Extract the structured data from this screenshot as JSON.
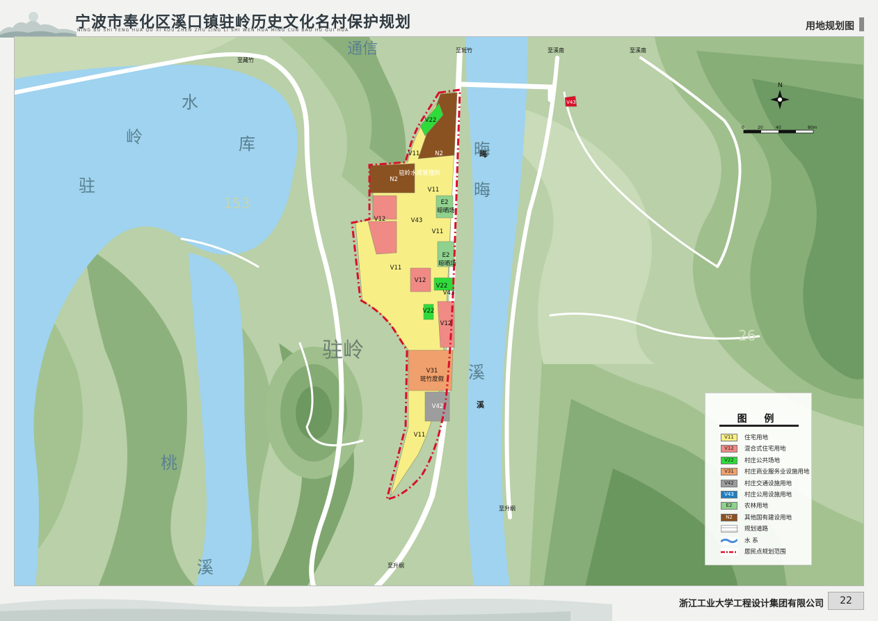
{
  "header": {
    "title": "宁波市奉化区溪口镇驻岭历史文化名村保护规划",
    "pinyin": "NING BO SHI FENG HUA QU XI KOU ZHEN ZHU LING LI SHI WEN HUA MING CUN BAO HU GUI HUA",
    "sheet_title": "用地规划图"
  },
  "footer": {
    "company": "浙江工业大学工程设计集团有限公司",
    "page_number": "22"
  },
  "map": {
    "place_labels": {
      "reservoir_chars": [
        "驻",
        "岭",
        "水",
        "库"
      ],
      "village": "驻岭",
      "stream_big": [
        "晦",
        "晦",
        "溪"
      ],
      "stream_small": [
        "晦",
        "溪"
      ],
      "peach": "桃",
      "xi": "溪",
      "tongxin": "通信"
    },
    "directions": {
      "to_zhuzhu": "至藏竹",
      "to_banzhu": "至斑竹",
      "to_xinan_1": "至溪南",
      "to_xinan_2": "至溪南",
      "to_shenggang_1": "至升纲",
      "to_shenggang_2": "至升纲"
    },
    "parcels": {
      "v22_top": "V22",
      "v11_a": "V11",
      "n2_right": "N2",
      "n2_left": "N2",
      "mgmt_name": "驻岭水库管理所",
      "v11_b": "V11",
      "e2_a": "E2",
      "e2_a_name": "晾晒场",
      "v12_a": "V12",
      "v43_a": "V43",
      "v11_c": "V11",
      "e2_b": "E2",
      "e2_b_name": "晾晒场",
      "v11_d": "V11",
      "v12_b": "V12",
      "v22_mid": "V22",
      "v43_b": "V43",
      "v22_low": "V22",
      "v12_c": "V12",
      "v31": "V31",
      "v31_name": "斑竹度假",
      "v42": "V42",
      "v11_e": "V11",
      "v43_east": "V43"
    },
    "scale": {
      "labels": [
        "0",
        "20",
        "40",
        "80m"
      ],
      "north": "N"
    },
    "contour_numbers": [
      "153",
      "26"
    ]
  },
  "legend": {
    "title": "图  例",
    "items": [
      {
        "code": "V11",
        "label": "住宅用地",
        "color": "#f7ef86"
      },
      {
        "code": "V12",
        "label": "混合式住宅用地",
        "color": "#f08a84"
      },
      {
        "code": "V22",
        "label": "村庄公共场地",
        "color": "#2edb3a"
      },
      {
        "code": "V31",
        "label": "村庄商业服务业设施用地",
        "color": "#f0a06c"
      },
      {
        "code": "V42",
        "label": "村庄交通设施用地",
        "color": "#9d9d9d"
      },
      {
        "code": "V43",
        "label": "村庄公用设施用地",
        "color": "#1f7fc2"
      },
      {
        "code": "E2",
        "label": "农林用地",
        "color": "#8fd18e"
      },
      {
        "code": "N2",
        "label": "其他国有建设用地",
        "color": "#8a5221"
      },
      {
        "code": "",
        "label": "规划道路",
        "color": "#ffffff"
      },
      {
        "code": "",
        "label": "水      系",
        "color": "#9ed3ef"
      },
      {
        "code": "",
        "label": "居民点规划范围",
        "color": "#d8102a"
      }
    ]
  }
}
